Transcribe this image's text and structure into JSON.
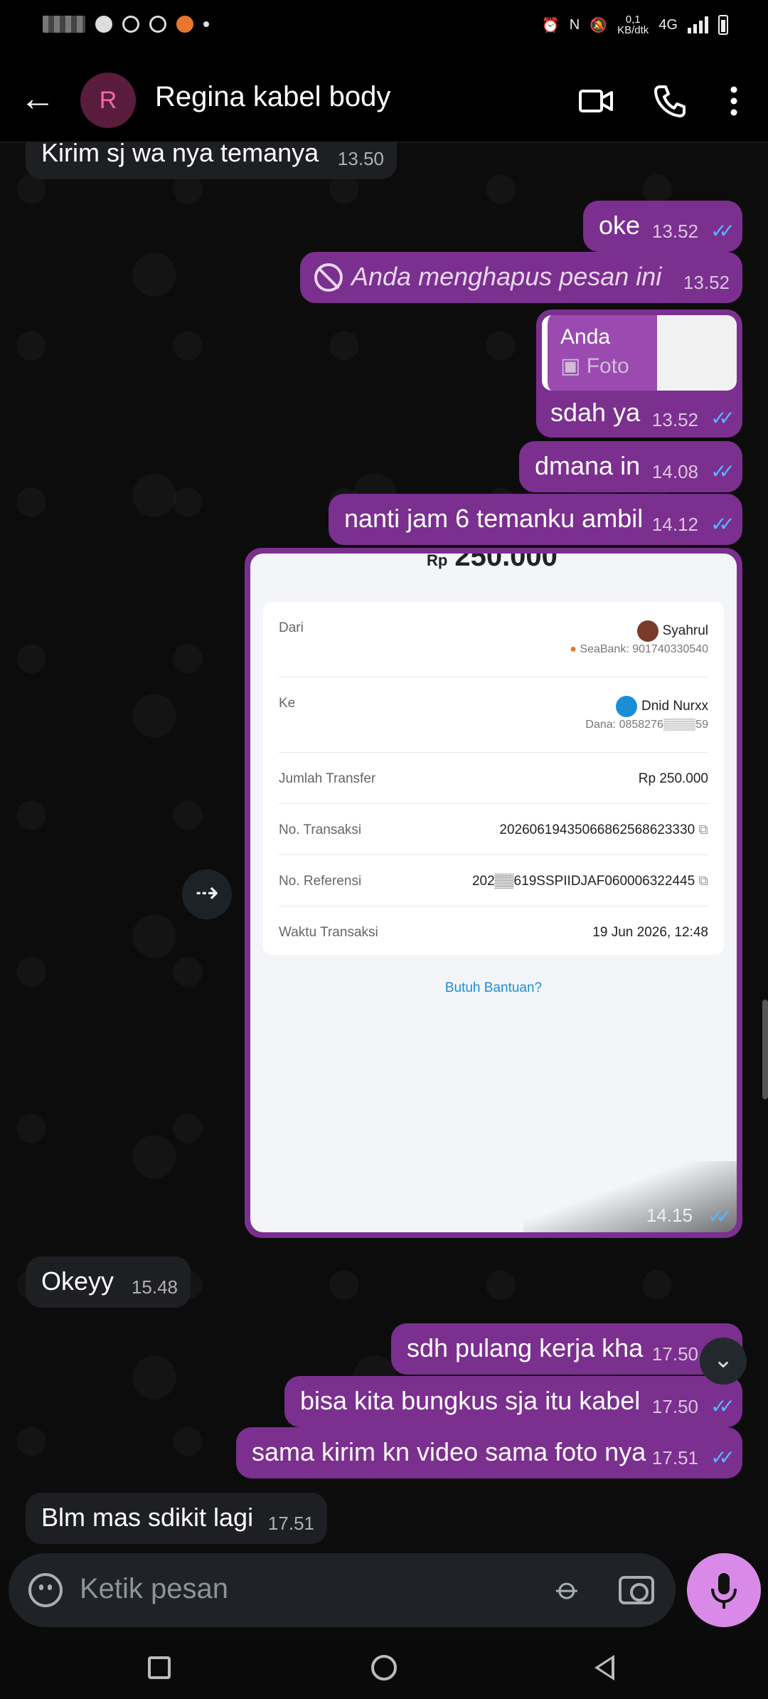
{
  "status_bar": {
    "net_speed_top": "0,1",
    "net_speed_unit": "KB/dtk",
    "network": "4G"
  },
  "header": {
    "avatar_letter": "R",
    "title": "Regina kabel body"
  },
  "messages": [
    {
      "dir": "in",
      "text": "Kirim sj wa nya temanya",
      "time": "13.50"
    },
    {
      "dir": "out",
      "text": "oke",
      "time": "13.52"
    },
    {
      "dir": "out",
      "text": "Anda menghapus pesan ini",
      "time": "13.52",
      "deleted": true
    },
    {
      "dir": "out",
      "text": "sdah ya",
      "time": "13.52",
      "quote_author": "Anda",
      "quote_text": "Foto"
    },
    {
      "dir": "out",
      "text": "dmana in",
      "time": "14.08"
    },
    {
      "dir": "out",
      "text": "nanti jam 6 temanku ambil",
      "time": "14.12"
    },
    {
      "dir": "out",
      "type": "image",
      "time": "14.15"
    },
    {
      "dir": "in",
      "text": "Okeyy",
      "time": "15.48"
    },
    {
      "dir": "out",
      "text": "sdh pulang kerja kha",
      "time": "17.50"
    },
    {
      "dir": "out",
      "text": "bisa kita bungkus sja itu kabel",
      "time": "17.50"
    },
    {
      "dir": "out",
      "text": "sama kirim kn video sama foto nya",
      "time": "17.51"
    },
    {
      "dir": "in",
      "text": "Blm mas sdikit lagi",
      "time": "17.51"
    }
  ],
  "receipt": {
    "currency": "Rp",
    "amount": "250.000",
    "from_label": "Dari",
    "from_name": "Syahrul",
    "from_account": "SeaBank: 901740330540",
    "to_label": "Ke",
    "to_name": "Dnid Nurxx",
    "to_account": "Dana: 0858276▒▒▒▒59",
    "amount_label": "Jumlah Transfer",
    "amount_value": "Rp 250.000",
    "trx_label": "No. Transaksi",
    "trx_value": "20260619435066862568623330",
    "ref_label": "No. Referensi",
    "ref_value": "202▒▒619SSPIIDJAF060006322445",
    "time_label": "Waktu Transaksi",
    "time_value": "19 Jun 2026, 12:48",
    "help": "Butuh Bantuan?"
  },
  "composer": {
    "placeholder": "Ketik pesan"
  },
  "icons": [
    "back-arrow-icon",
    "video-call-icon",
    "phone-icon",
    "more-options-icon",
    "forward-icon",
    "scroll-down-icon",
    "emoji-icon",
    "attach-icon",
    "camera-icon",
    "mic-icon"
  ],
  "colors": {
    "out_bubble": "#7b2f8f",
    "in_bubble": "#1e1f22",
    "read_ticks": "#57b6ff",
    "mic": "#d98ae8"
  }
}
